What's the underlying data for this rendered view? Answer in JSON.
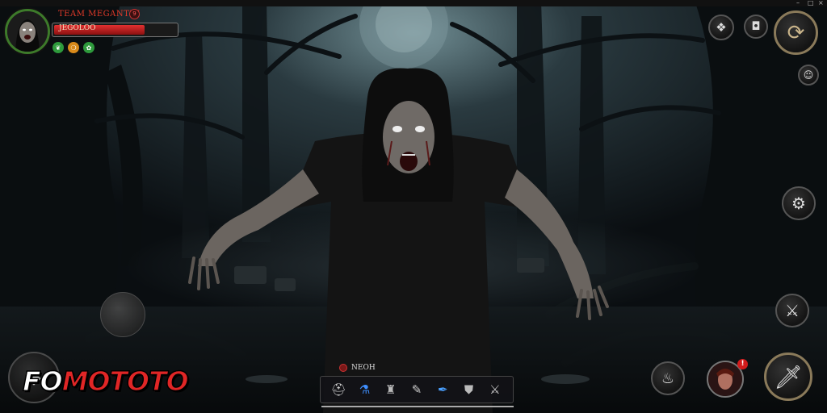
{
  "player": {
    "name": "TEAM MEGANTUI",
    "badge": "9",
    "hp_text": "JEGOLOO",
    "hp_fraction": 0.74,
    "status_icons": [
      {
        "icon": "leaf-icon",
        "color": "#2e9a3c",
        "glyph": "❦"
      },
      {
        "icon": "flame-icon",
        "color": "#d98a1a",
        "glyph": "❍"
      },
      {
        "icon": "clover-icon",
        "color": "#2e9a3c",
        "glyph": "✿"
      }
    ]
  },
  "hotbar": {
    "label": "NEOH",
    "slots": [
      {
        "name": "helmet-icon",
        "glyph": "⛑",
        "color": "#cfcfcf"
      },
      {
        "name": "potion-blue-icon",
        "glyph": "⚗",
        "color": "#3f8fff"
      },
      {
        "name": "armor-icon",
        "glyph": "♜",
        "color": "#bbbbbb"
      },
      {
        "name": "wrench-icon",
        "glyph": "✎",
        "color": "#cccccc"
      },
      {
        "name": "feather-icon",
        "glyph": "✒",
        "color": "#4aa0ff"
      },
      {
        "name": "shield-icon",
        "glyph": "⛊",
        "color": "#bbbbbb"
      },
      {
        "name": "crossed-swords-icon",
        "glyph": "⚔",
        "color": "#cccccc"
      }
    ]
  },
  "logo": {
    "part1": "FO",
    "part2": "MOTOTO"
  },
  "notification": {
    "count": "!"
  },
  "colors": {
    "hp": "#e23030",
    "accent": "#e02626",
    "frame": "#3d7a2a"
  }
}
